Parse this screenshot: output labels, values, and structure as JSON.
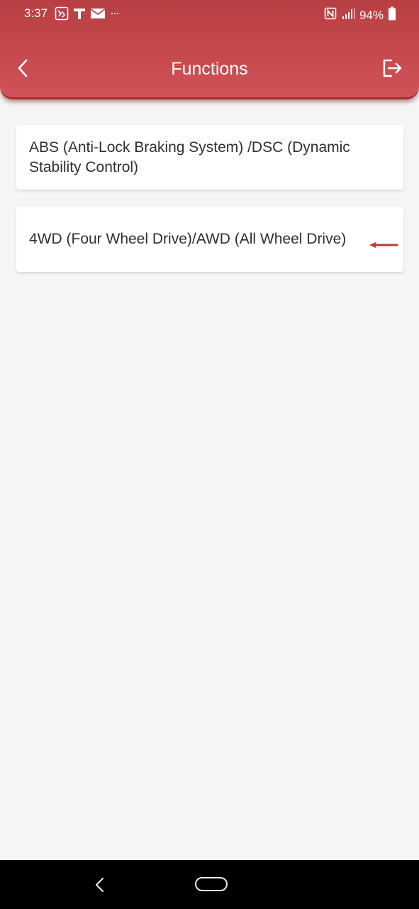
{
  "status_bar": {
    "time": "3:37",
    "battery": "94%",
    "left_icons": [
      "app-notification-icon",
      "t-icon",
      "mail-icon",
      "more-dots-icon"
    ],
    "right_icons": [
      "nfc-icon",
      "signal-icon",
      "battery-icon"
    ]
  },
  "header": {
    "title": "Functions",
    "back_icon": "chevron-left-icon",
    "exit_icon": "logout-icon",
    "color": "#c4474b"
  },
  "functions": [
    {
      "label": "ABS (Anti-Lock Braking System) /DSC (Dynamic Stability Control)"
    },
    {
      "label": "4WD (Four Wheel Drive)/AWD (All Wheel Drive)"
    }
  ],
  "annotation": {
    "icon": "red-arrow-icon",
    "color": "#c0393d"
  },
  "system_nav": {
    "back_icon": "nav-back-icon",
    "home_icon": "nav-home-pill-icon"
  }
}
